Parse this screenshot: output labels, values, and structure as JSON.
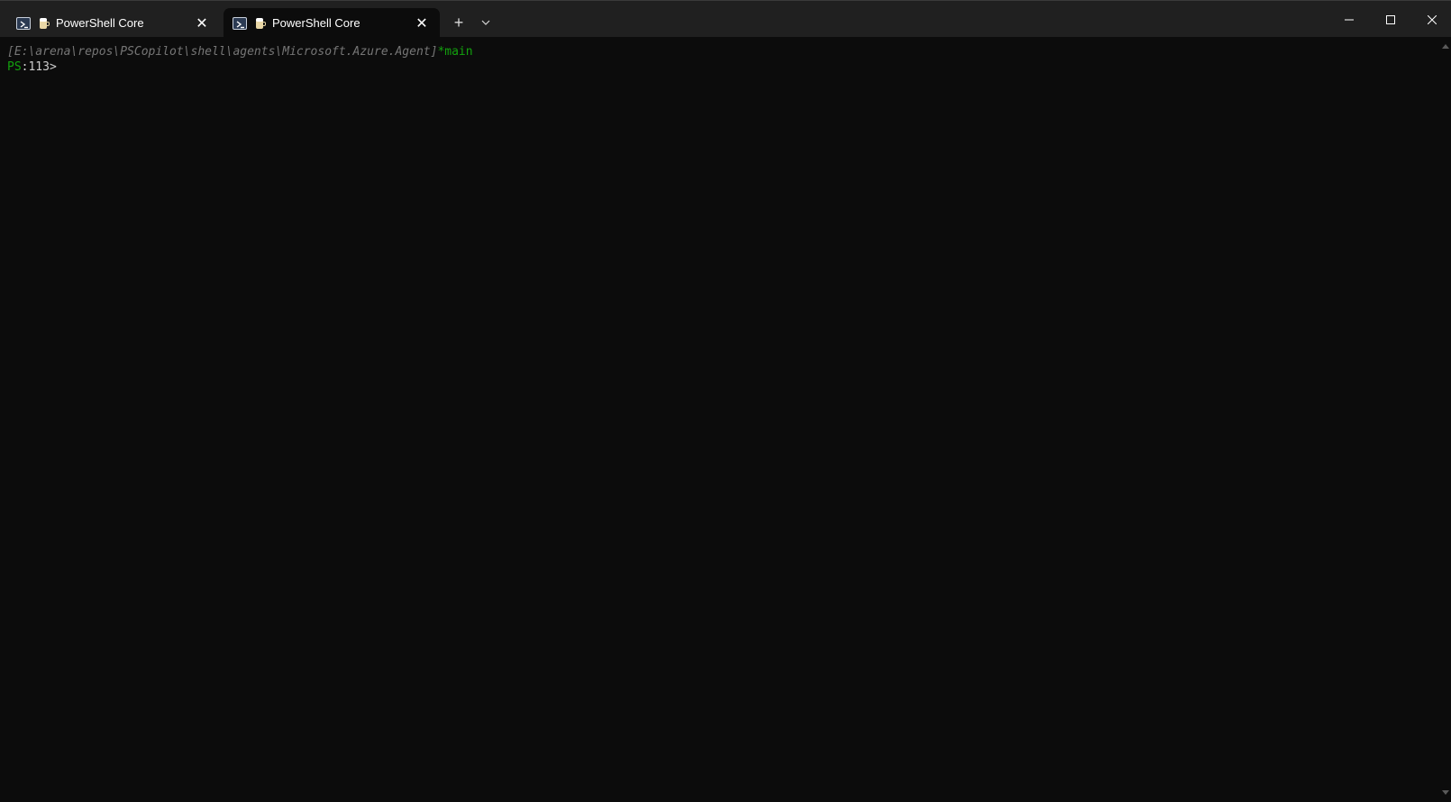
{
  "tabs": [
    {
      "label": "PowerShell Core",
      "active": false,
      "icon": "powershell-icon",
      "profile_icon": "beer-mug-icon"
    },
    {
      "label": "PowerShell Core",
      "active": true,
      "icon": "powershell-icon",
      "profile_icon": "beer-mug-icon"
    }
  ],
  "tabbar": {
    "new_tab_glyph": "+",
    "close_glyph": "✕"
  },
  "terminal": {
    "path_line": "[E:\\arena\\repos\\PSCopilot\\shell\\agents\\Microsoft.Azure.Agent]",
    "branch": "*main",
    "prompt_ps": "PS",
    "prompt_rest": ":113>"
  },
  "colors": {
    "background": "#0c0c0c",
    "titlebar": "#202020",
    "path": "#767676",
    "green": "#13a10e",
    "text": "#cccccc"
  }
}
